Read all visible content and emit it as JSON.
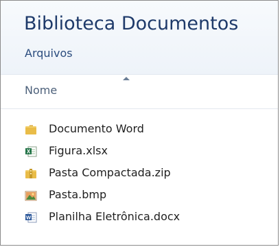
{
  "library": {
    "title": "Biblioteca Documentos",
    "subtitle": "Arquivos"
  },
  "columns": {
    "name": "Nome"
  },
  "files": [
    {
      "name": "Documento Word",
      "icon": "folder-icon"
    },
    {
      "name": "Figura.xlsx",
      "icon": "excel-file-icon"
    },
    {
      "name": "Pasta Compactada.zip",
      "icon": "zip-folder-icon"
    },
    {
      "name": "Pasta.bmp",
      "icon": "bitmap-image-icon"
    },
    {
      "name": "Planilha Eletrônica.docx",
      "icon": "word-file-icon"
    }
  ]
}
